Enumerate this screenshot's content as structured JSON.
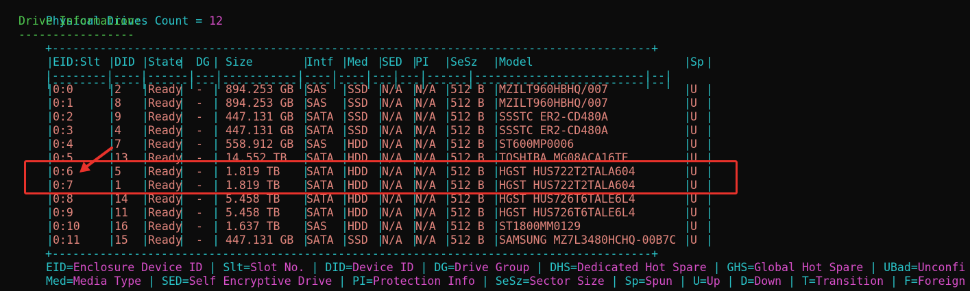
{
  "header": {
    "count_label": "Physical Drives Count = ",
    "count_value": "12",
    "section_title": "Drive Information:",
    "section_rule": "-----------------"
  },
  "table": {
    "border": "+----------------------------------------------------------------------------------------+",
    "rule": "|--------|----|------|---|-----------|----|----|---|---|------|-------------------------|--|",
    "columns": [
      "EID:Slt",
      "DID",
      "State",
      "DG",
      "Size",
      "Intf",
      "Med",
      "SED",
      "PI",
      "SeSz",
      "Model",
      "Sp"
    ],
    "rows": [
      [
        "0:0",
        "2",
        "Ready",
        "-",
        "894.253 GB",
        "SAS",
        "SSD",
        "N/A",
        "N/A",
        "512 B",
        "MZILT960HBHQ/007",
        "U"
      ],
      [
        "0:1",
        "8",
        "Ready",
        "-",
        "894.253 GB",
        "SAS",
        "SSD",
        "N/A",
        "N/A",
        "512 B",
        "MZILT960HBHQ/007",
        "U"
      ],
      [
        "0:2",
        "9",
        "Ready",
        "-",
        "447.131 GB",
        "SATA",
        "SSD",
        "N/A",
        "N/A",
        "512 B",
        "SSSTC ER2-CD480A",
        "U"
      ],
      [
        "0:3",
        "4",
        "Ready",
        "-",
        "447.131 GB",
        "SATA",
        "SSD",
        "N/A",
        "N/A",
        "512 B",
        "SSSTC ER2-CD480A",
        "U"
      ],
      [
        "0:4",
        "7",
        "Ready",
        "-",
        "558.912 GB",
        "SAS",
        "HDD",
        "N/A",
        "N/A",
        "512 B",
        "ST600MP0006",
        "U"
      ],
      [
        "0:5",
        "13",
        "Ready",
        "-",
        "14.552 TB",
        "SATA",
        "HDD",
        "N/A",
        "N/A",
        "512 B",
        "TOSHIBA MG08ACA16TE",
        "U"
      ],
      [
        "0:6",
        "5",
        "Ready",
        "-",
        "1.819 TB",
        "SATA",
        "HDD",
        "N/A",
        "N/A",
        "512 B",
        "HGST HUS722T2TALA604",
        "U"
      ],
      [
        "0:7",
        "1",
        "Ready",
        "-",
        "1.819 TB",
        "SATA",
        "HDD",
        "N/A",
        "N/A",
        "512 B",
        "HGST HUS722T2TALA604",
        "U"
      ],
      [
        "0:8",
        "14",
        "Ready",
        "-",
        "5.458 TB",
        "SATA",
        "HDD",
        "N/A",
        "N/A",
        "512 B",
        "HGST HUS726T6TALE6L4",
        "U"
      ],
      [
        "0:9",
        "11",
        "Ready",
        "-",
        "5.458 TB",
        "SATA",
        "HDD",
        "N/A",
        "N/A",
        "512 B",
        "HGST HUS726T6TALE6L4",
        "U"
      ],
      [
        "0:10",
        "16",
        "Ready",
        "-",
        "1.637 TB",
        "SAS",
        "HDD",
        "N/A",
        "N/A",
        "512 B",
        "ST1800MM0129",
        "U"
      ],
      [
        "0:11",
        "15",
        "Ready",
        "-",
        "447.131 GB",
        "SATA",
        "SSD",
        "N/A",
        "N/A",
        "512 B",
        "SAMSUNG MZ7L3480HCHQ-00B7C",
        "U"
      ]
    ],
    "highlighted_slots": [
      "0:6",
      "0:7"
    ]
  },
  "legend": {
    "line1": [
      {
        "k": "EID",
        "v": "Enclosure Device ID"
      },
      {
        "k": "Slt",
        "v": "Slot No."
      },
      {
        "k": "DID",
        "v": "Device ID"
      },
      {
        "k": "DG",
        "v": "Drive Group"
      },
      {
        "k": "DHS",
        "v": "Dedicated Hot Spare"
      },
      {
        "k": "GHS",
        "v": "Global Hot Spare"
      },
      {
        "k": "UBad",
        "v": "Unconfi"
      }
    ],
    "line2": [
      {
        "k": "Med",
        "v": "Media Type"
      },
      {
        "k": "SED",
        "v": "Self Encryptive Drive"
      },
      {
        "k": "PI",
        "v": "Protection Info"
      },
      {
        "k": "SeSz",
        "v": "Sector Size"
      },
      {
        "k": "Sp",
        "v": "Spun"
      },
      {
        "k": "U",
        "v": "Up"
      },
      {
        "k": "D",
        "v": "Down"
      },
      {
        "k": "T",
        "v": "Transition"
      },
      {
        "k": "F",
        "v": "Foreign"
      }
    ]
  },
  "colors": {
    "background": "#0c0c0c",
    "key_text": "#2ac3c8",
    "value_text": "#d84fc9",
    "title_text": "#4fc84f",
    "cell_text": "#e2867d",
    "highlight": "#e8322b"
  }
}
